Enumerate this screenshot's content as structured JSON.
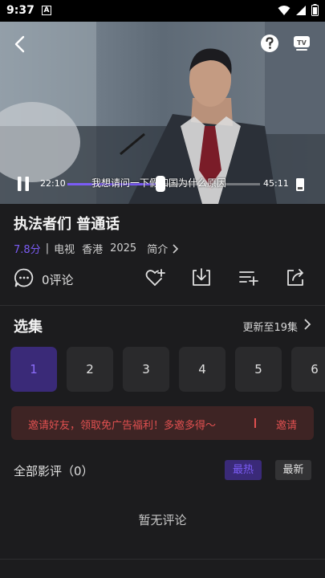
{
  "status_bar": {
    "time": "9:37",
    "badge": "A"
  },
  "player": {
    "current_time": "22:10",
    "total_time": "45:11",
    "progress": 0.49,
    "subtitle": "我想请问一下假如国为什么原因"
  },
  "show": {
    "title": "执法者们 普通话",
    "score": "7.8分",
    "separator": "|",
    "type": "电视",
    "region": "香港",
    "year": "2025",
    "intro_label": "简介"
  },
  "actions": {
    "comment_count": "0评论"
  },
  "episodes": {
    "section_title": "选集",
    "update_text": "更新至19集",
    "items": [
      "1",
      "2",
      "3",
      "4",
      "5",
      "6"
    ],
    "active": "1"
  },
  "invite_banner": {
    "text": "邀请好友，领取免广告福利！多邀多得～",
    "button": "邀请"
  },
  "reviews": {
    "title": "全部影评（0）",
    "sort_hot": "最热",
    "sort_new": "最新",
    "empty_text": "暂无评论"
  },
  "colors": {
    "accent": "#7b5cf5",
    "invite_red": "#e05050",
    "background": "#1c1c1e"
  }
}
